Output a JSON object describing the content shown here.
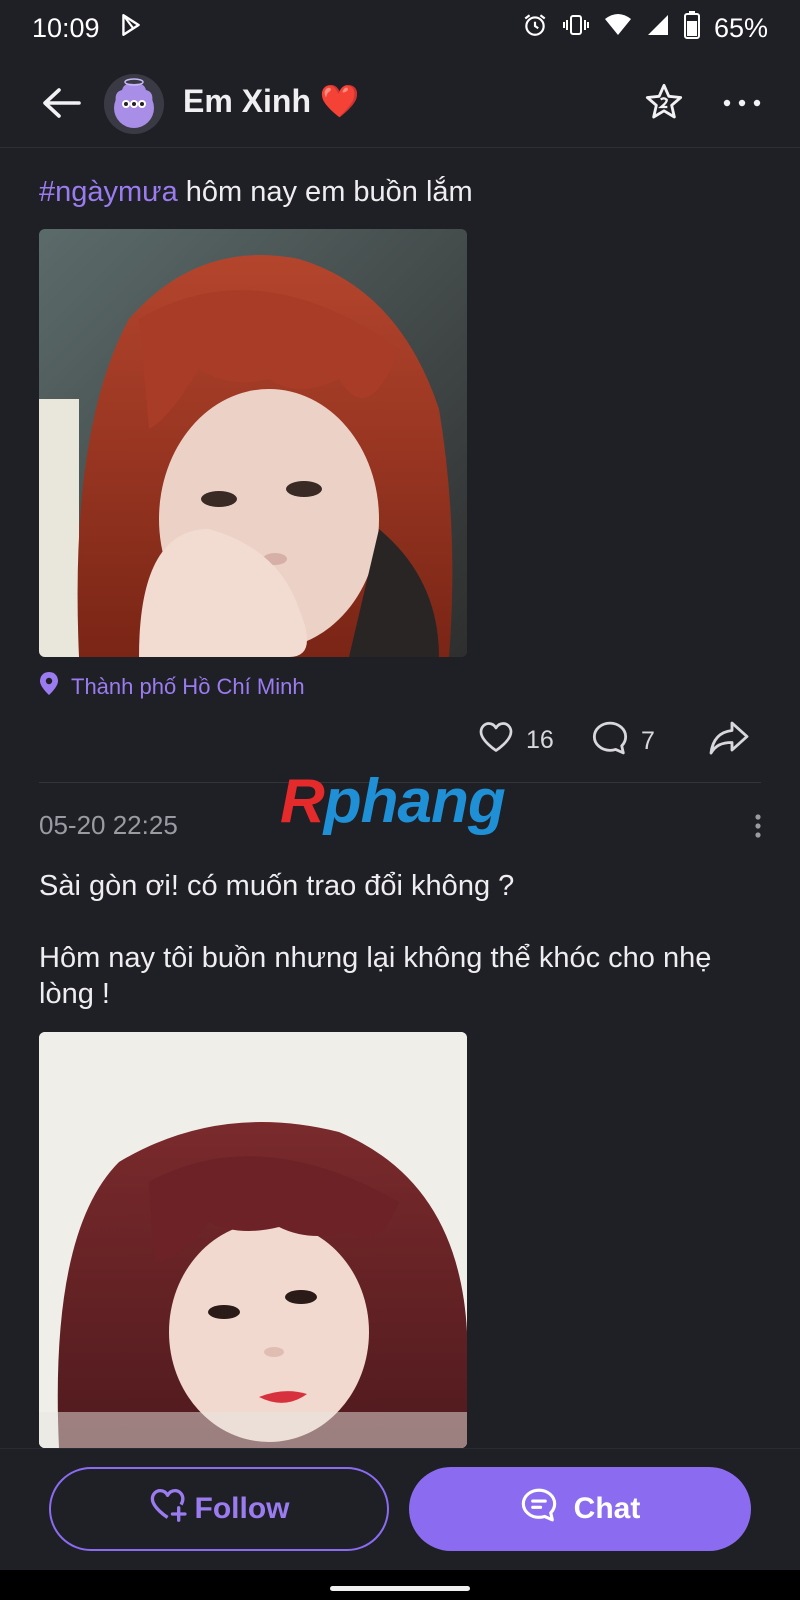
{
  "status_bar": {
    "time": "10:09",
    "battery": "65%",
    "icons": [
      "play-store-icon",
      "alarm-icon",
      "vibrate-icon",
      "wifi-icon",
      "signal-icon",
      "battery-icon"
    ]
  },
  "header": {
    "title": "Em Xinh ❤️",
    "icons": [
      "back-arrow-icon",
      "avatar",
      "star-icon",
      "more-icon"
    ]
  },
  "post1": {
    "hashtag": "#ngàymưa",
    "caption": " hôm nay em buồn lắm",
    "location": "Thành phố Hồ Chí Minh",
    "likes": "16",
    "comments": "7"
  },
  "watermark": {
    "first": "R",
    "rest": "phang"
  },
  "post2": {
    "date": "05-20 22:25",
    "line1": "Sài gòn ơi! có muốn trao đổi không ?",
    "line2": "Hôm nay tôi buồn nhưng lại không thể khóc cho nhẹ lòng !"
  },
  "bottom": {
    "follow_label": "Follow",
    "chat_label": "Chat"
  },
  "colors": {
    "background": "#1f1f26",
    "accent": "#8b6cf0",
    "hashtag": "#9b7cf0"
  }
}
